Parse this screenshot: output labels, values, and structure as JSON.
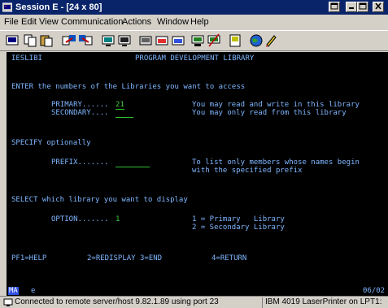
{
  "window": {
    "title": "Session E - [24 x 80]"
  },
  "menu": {
    "items": [
      "File",
      "Edit",
      "View",
      "Communication",
      "Actions",
      "Window",
      "Help"
    ]
  },
  "screen": {
    "header_left": "IESLIBI",
    "header_title": "PROGRAM DEVELOPMENT LIBRARY",
    "enter_label": "ENTER the numbers of the Libraries you want to access",
    "primary_label": "PRIMARY......",
    "primary_value": "21",
    "primary_help": "You may read and write in this library",
    "secondary_label": "SECONDARY....",
    "secondary_value": "",
    "secondary_help": "You may only read from this library",
    "specify_label": "SPECIFY optionally",
    "prefix_label": "PREFIX.......",
    "prefix_value": "",
    "prefix_help_1": "To list only members whose names begin",
    "prefix_help_2": "with the specified prefix",
    "select_label": "SELECT which library you want to display",
    "option_label": "OPTION.......",
    "option_value": "1",
    "option_help_1": "1 = Primary   Library",
    "option_help_2": "2 = Secondary Library",
    "pf1": "PF1=HELP",
    "pf2": "2=REDISPLAY",
    "pf3": "3=END",
    "pf4": "4=RETURN"
  },
  "oia": {
    "indicator": "MA",
    "mode": "e",
    "cursor": "06/02"
  },
  "status": {
    "connection": "Connected to remote server/host 9.82.1.89 using port 23",
    "printer": "IBM 4019 LaserPrinter on LPT1:"
  }
}
